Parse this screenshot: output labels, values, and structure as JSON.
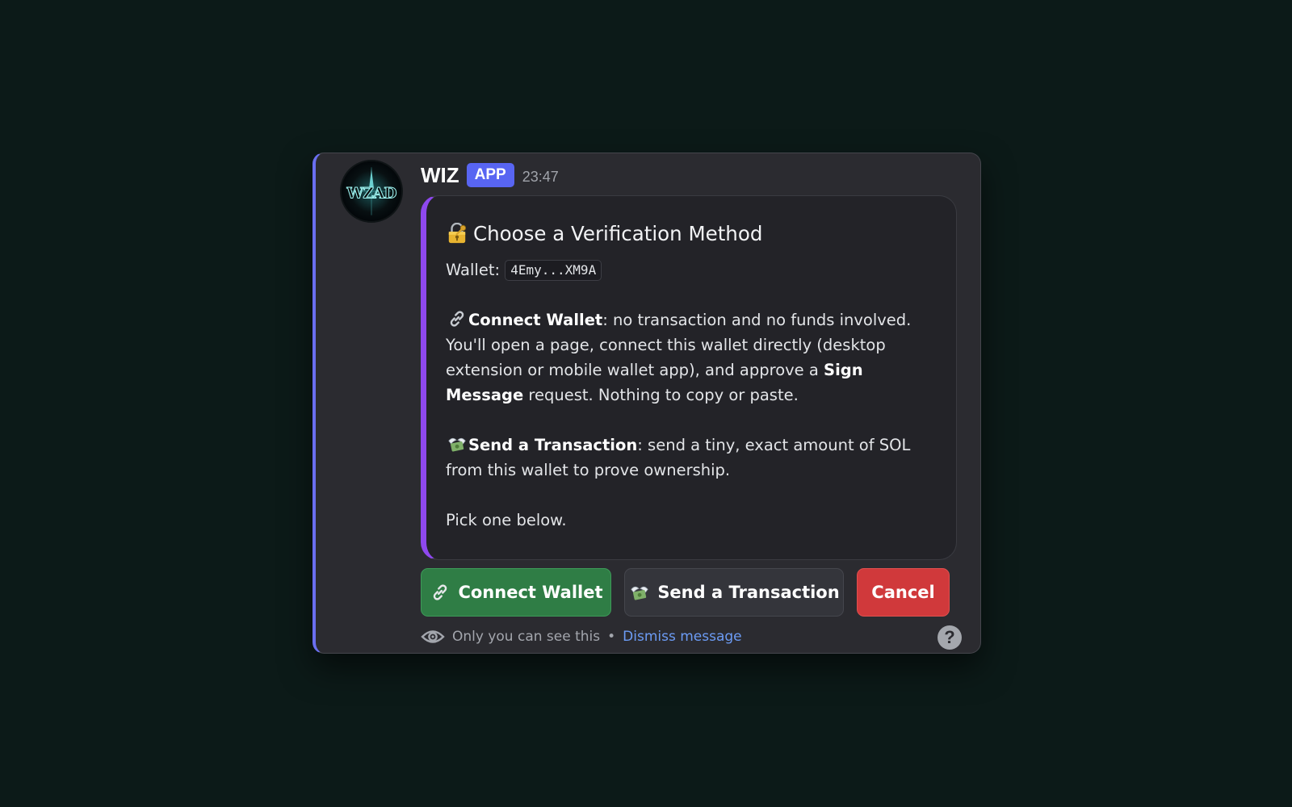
{
  "message": {
    "username": "WIZ",
    "badge": "APP",
    "timestamp": "23:47",
    "avatar_text": "WZAD"
  },
  "embed": {
    "accent_color": "#8e48ee",
    "title_icon": "lock-with-key-icon",
    "title": "Choose a Verification Method",
    "wallet_label": "Wallet:",
    "wallet_value": "4Emy...XM9A",
    "option1_icon": "link-icon",
    "option1_name": "Connect Wallet",
    "option1_text_a": ": no transaction and no funds involved. You'll open a page, connect this wallet directly (desktop extension or mobile wallet app), and approve a ",
    "option1_bold2": "Sign Message",
    "option1_text_b": " request. Nothing to copy or paste.",
    "option2_icon": "money-with-wings-icon",
    "option2_name": "Send a Transaction",
    "option2_text": ": send a tiny, exact amount of SOL from this wallet to prove ownership.",
    "footer_line": "Pick one below."
  },
  "buttons": {
    "connect_label": "Connect Wallet",
    "connect_icon": "link-icon",
    "connect_color": "#2f7d45",
    "send_label": "Send a Transaction",
    "send_icon": "money-with-wings-icon",
    "send_color": "#34353b",
    "cancel_label": "Cancel",
    "cancel_color": "#d0393b"
  },
  "ephemeral": {
    "icon": "eye-icon",
    "note": "Only you can see this",
    "separator": "•",
    "dismiss_label": "Dismiss message"
  },
  "help": {
    "icon": "question-icon",
    "glyph": "?"
  },
  "colors": {
    "page_bg": "#0c1a18",
    "card_bg": "#2b2b30",
    "left_accent": "#6a6ff0",
    "badge_bg": "#5865f2",
    "link": "#6c9cf5"
  }
}
